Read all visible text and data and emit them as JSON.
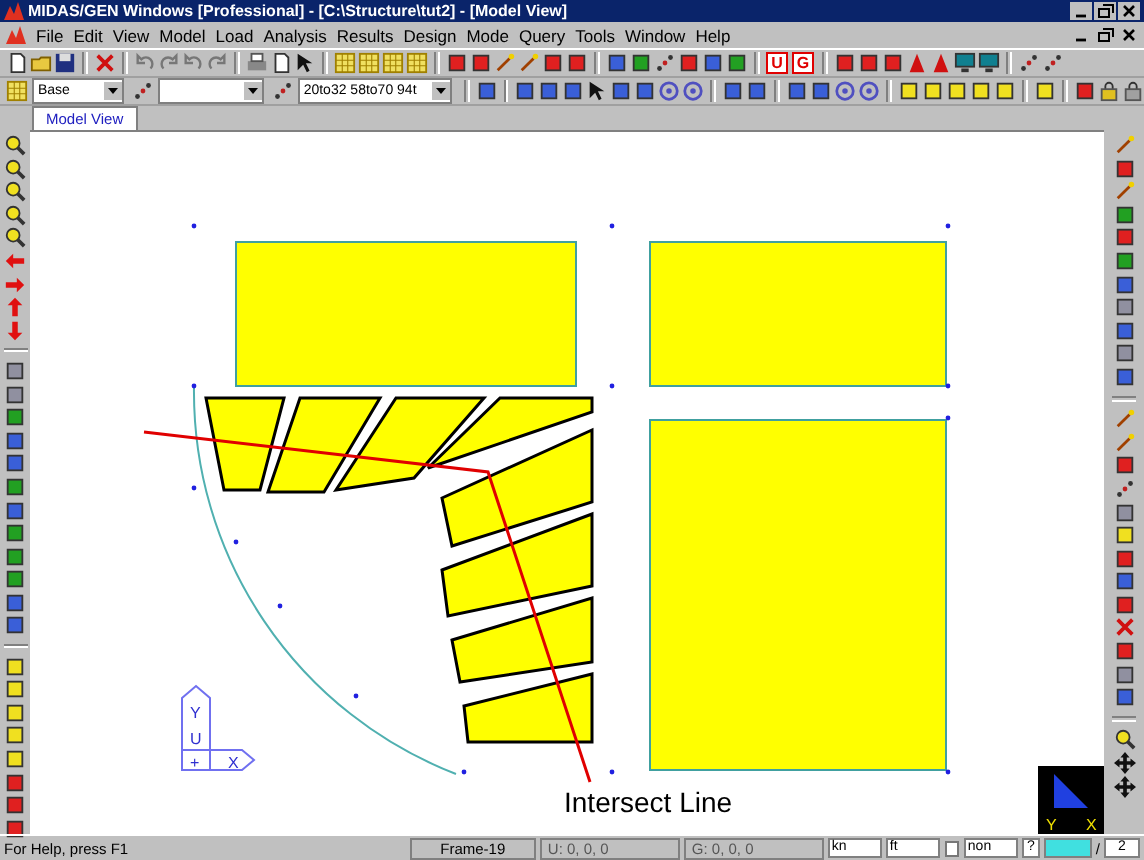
{
  "window": {
    "title": "MIDAS/GEN Windows [Professional] - [C:\\Structure\\tut2] - [Model View]"
  },
  "menu_bar": {
    "items": [
      "File",
      "Edit",
      "View",
      "Model",
      "Load",
      "Analysis",
      "Results",
      "Design",
      "Mode",
      "Query",
      "Tools",
      "Window",
      "Help"
    ]
  },
  "toolbar_1": {
    "letter_buttons": [
      "U",
      "G"
    ]
  },
  "toolbar_2": {
    "combos": [
      {
        "kind": "story",
        "value": "Base"
      },
      {
        "kind": "blank"
      },
      {
        "kind": "selection",
        "value": "20to32 58to70 94t"
      }
    ]
  },
  "tabs": [
    {
      "label": "Model View",
      "selected": true
    }
  ],
  "canvas": {
    "annotation": "Intersect Line",
    "ucs_triad": {
      "y_label": "Y",
      "origin_label": "U",
      "sign": "+",
      "x_label": "X"
    },
    "view_triad": {
      "y_label": "Y",
      "x_label": "X"
    }
  },
  "status_bar": {
    "help": "For Help, press F1",
    "frame": "Frame-19",
    "ucs_coords": "U: 0, 0, 0",
    "global_coords": "G: 0, 0, 0",
    "force_unit": "kn",
    "length_unit": "ft",
    "mode": "non",
    "help_mark": "?",
    "separator": "/",
    "page": "2"
  }
}
